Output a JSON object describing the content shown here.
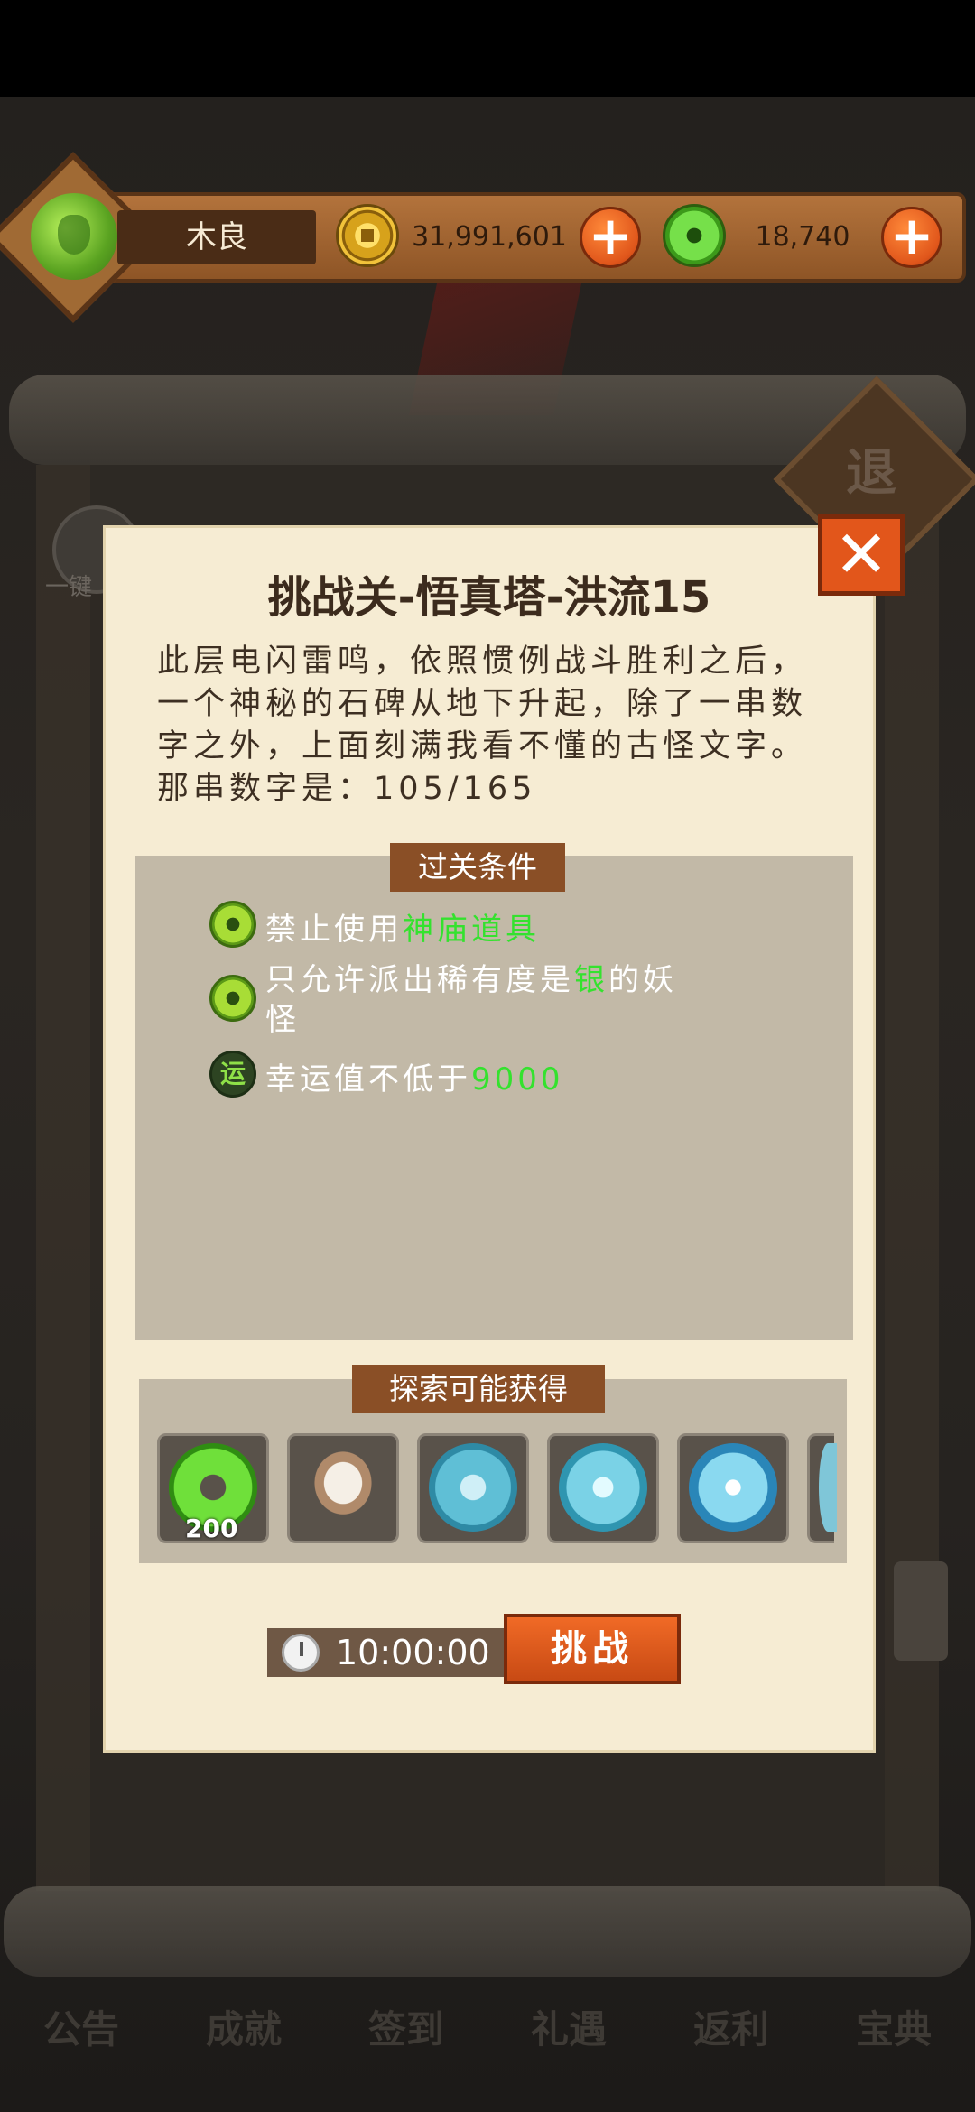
{
  "player": {
    "name": "木良",
    "avatar": "jade-spirit-avatar-icon"
  },
  "currency": {
    "coins": "31,991,601",
    "jade": "18,740",
    "plus": "+"
  },
  "background": {
    "sign_char": "退",
    "left_badge": "一键",
    "nav": [
      "公告",
      "成就",
      "签到",
      "礼遇",
      "返利",
      "宝典"
    ]
  },
  "dialog": {
    "title": "挑战关-悟真塔-洪流15",
    "story": "此层电闪雷鸣，依照惯例战斗胜利之后，一个神秘的石碑从地下升起，除了一串数字之外，上面刻满我看不懂的古怪文字。那串数字是：105/165",
    "close": "✕",
    "conditions_header": "过关条件",
    "conditions": [
      {
        "prefix": "禁止使用",
        "highlight": "神庙道具",
        "suffix": "",
        "icon": "jade-bullet-icon"
      },
      {
        "prefix": "只允许派出稀有度是",
        "highlight": "银",
        "suffix": "的妖",
        "line2": "怪",
        "icon": "jade-bullet-icon"
      },
      {
        "prefix": "幸运值不低于",
        "highlight": "9000",
        "suffix": "",
        "icon": "luck-icon",
        "icon_char": "运"
      }
    ],
    "rewards_header": "探索可能获得",
    "rewards": [
      {
        "icon": "jade-coin-icon",
        "count": "200"
      },
      {
        "icon": "hamster-pet-icon",
        "count": ""
      },
      {
        "icon": "ice-rune-icon",
        "count": ""
      },
      {
        "icon": "ice-crystal-icon",
        "count": ""
      },
      {
        "icon": "ice-orb-icon",
        "count": ""
      },
      {
        "icon": "ice-partial-icon",
        "count": ""
      }
    ],
    "timer": "10:00:00",
    "challenge_button": "挑战"
  },
  "colors": {
    "highlight": "#34e22e",
    "accent_orange": "#e2561b",
    "parchment": "#f6ecd3"
  }
}
